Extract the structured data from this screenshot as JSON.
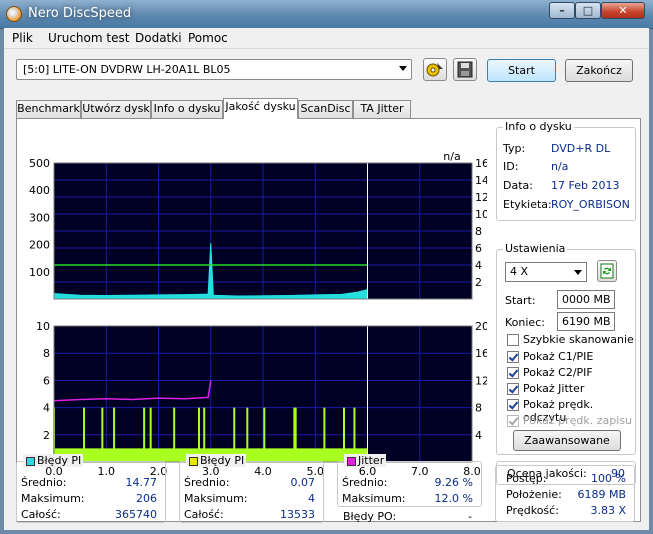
{
  "window": {
    "title": "Nero DiscSpeed",
    "minimize": "–",
    "maximize": "□",
    "close": "✕"
  },
  "menu": [
    "Plik",
    "Uruchom test",
    "Dodatki",
    "Pomoc"
  ],
  "toolbar": {
    "drive": "[5:0]   LITE-ON DVDRW LH-20A1L BL05",
    "start_label": "Start",
    "exit_label": "Zakończ",
    "icons": [
      "eject-icon",
      "save-icon"
    ]
  },
  "tabs": [
    "Benchmark",
    "Utwórz dysk",
    "Info o dysku",
    "Jakość dysku",
    "ScanDisc",
    "TA Jitter"
  ],
  "active_tab": "Jakość dysku",
  "disc_info": {
    "title": "Info o dysku",
    "rows": [
      {
        "label": "Typ:",
        "value": "DVD+R DL"
      },
      {
        "label": "ID:",
        "value": "n/a"
      },
      {
        "label": "Data:",
        "value": "17 Feb 2013"
      },
      {
        "label": "Etykieta:",
        "value": "ROY_ORBISON"
      }
    ]
  },
  "settings": {
    "title": "Ustawienia",
    "speed": "4 X",
    "start_label": "Start:",
    "start_value": "0000 MB",
    "end_label": "Koniec:",
    "end_value": "6190 MB",
    "checkboxes": [
      {
        "label": "Szybkie skanowanie",
        "checked": false,
        "disabled": false
      },
      {
        "label": "Pokaż C1/PIE",
        "checked": true,
        "disabled": false
      },
      {
        "label": "Pokaż C2/PIF",
        "checked": true,
        "disabled": false
      },
      {
        "label": "Pokaż Jitter",
        "checked": true,
        "disabled": false
      },
      {
        "label": "Pokaż prędk. odczytu",
        "checked": true,
        "disabled": false
      },
      {
        "label": "Pokaż prędk. zapisu",
        "checked": true,
        "disabled": true
      }
    ],
    "advanced_label": "Zaawansowane"
  },
  "quality": {
    "label": "Ocena jakości:",
    "value": "90"
  },
  "progress": {
    "rows": [
      {
        "label": "Postęp:",
        "value": "100 %"
      },
      {
        "label": "Położenie:",
        "value": "6189 MB"
      },
      {
        "label": "Prędkość:",
        "value": "3.83 X"
      }
    ]
  },
  "stats": {
    "pi": {
      "title": "Błędy PI",
      "color": "#22e0e0",
      "rows": [
        {
          "label": "Średnio:",
          "value": "14.77"
        },
        {
          "label": "Maksimum:",
          "value": "206"
        },
        {
          "label": "Całość:",
          "value": "365740"
        }
      ]
    },
    "pif": {
      "title": "Błędy PI",
      "color": "#e8e800",
      "rows": [
        {
          "label": "Średnio:",
          "value": "0.07"
        },
        {
          "label": "Maksimum:",
          "value": "4"
        },
        {
          "label": "Całość:",
          "value": "13533"
        }
      ]
    },
    "jitter": {
      "title": "Jitter",
      "color": "#e020e0",
      "rows": [
        {
          "label": "Średnio:",
          "value": "9.26 %"
        },
        {
          "label": "Maksimum:",
          "value": "12.0 %"
        }
      ]
    },
    "po": {
      "label": "Błędy PO:",
      "value": "-"
    }
  },
  "chart_data": [
    {
      "type": "area",
      "corner_label": "n/a",
      "x": {
        "range": [
          0,
          8
        ],
        "ticks": [
          "0.0",
          "1.0",
          "2.0",
          "3.0",
          "4.0",
          "5.0",
          "6.0",
          "7.0",
          "8.0"
        ]
      },
      "y_left": {
        "range": [
          0,
          500
        ],
        "ticks": [
          "100",
          "200",
          "300",
          "400",
          "500"
        ]
      },
      "y_right": {
        "range": [
          0,
          16
        ],
        "ticks": [
          "2",
          "4",
          "6",
          "8",
          "10",
          "12",
          "14",
          "16"
        ]
      },
      "series": [
        {
          "color": "#22e0e0",
          "x": [
            0,
            0.5,
            1.0,
            1.5,
            2.0,
            2.5,
            2.95,
            3.0,
            3.05,
            3.5,
            4.0,
            4.5,
            5.0,
            5.5,
            5.8,
            6.0
          ],
          "values": [
            20,
            14,
            13,
            14,
            15,
            16,
            18,
            206,
            14,
            11,
            12,
            13,
            15,
            17,
            25,
            35
          ]
        },
        {
          "color": "#22dd22",
          "axis": "right",
          "x": [
            0,
            6.0
          ],
          "values": [
            4.0,
            4.0
          ]
        }
      ],
      "marker_x": 6.0
    },
    {
      "type": "bar",
      "x": {
        "range": [
          0,
          8
        ],
        "ticks": [
          "0.0",
          "1.0",
          "2.0",
          "3.0",
          "4.0",
          "5.0",
          "6.0",
          "7.0",
          "8.0"
        ]
      },
      "y_left": {
        "range": [
          0,
          10
        ],
        "ticks": [
          "2",
          "4",
          "6",
          "8",
          "10"
        ]
      },
      "y_right": {
        "range": [
          0,
          20
        ],
        "ticks": [
          "4",
          "8",
          "12",
          "16",
          "20"
        ]
      },
      "series": [
        {
          "color": "#a8ff20",
          "typical": 1,
          "max": 4,
          "x_range": [
            0,
            6.0
          ]
        },
        {
          "color": "#e020e0",
          "axis": "right",
          "x": [
            0,
            0.5,
            1.0,
            1.5,
            2.0,
            2.5,
            2.95,
            3.0
          ],
          "values": [
            9.0,
            9.2,
            9.3,
            9.2,
            9.4,
            9.3,
            9.5,
            12.0
          ]
        }
      ],
      "marker_x": 6.0
    }
  ]
}
